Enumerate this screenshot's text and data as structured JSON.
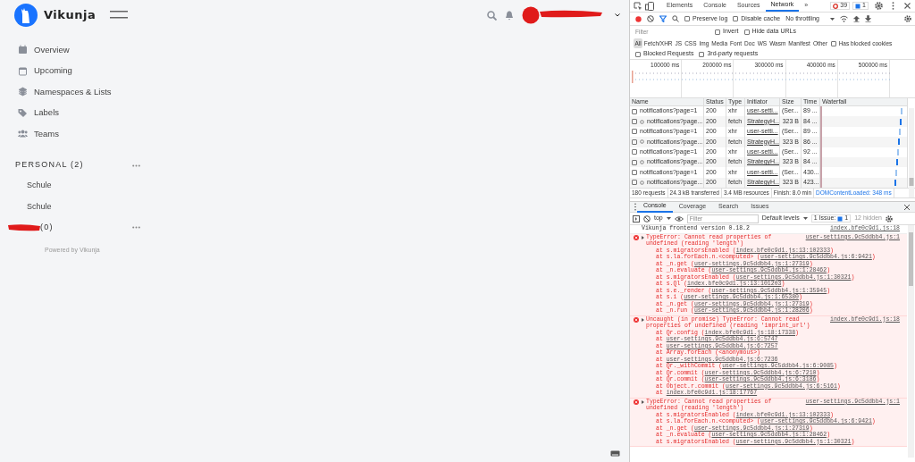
{
  "app": {
    "brand": "Vikunja",
    "header": {
      "user": {
        "redacted": true
      }
    },
    "nav": [
      {
        "label": "Overview"
      },
      {
        "label": "Upcoming"
      },
      {
        "label": "Namespaces & Lists"
      },
      {
        "label": "Labels"
      },
      {
        "label": "Teams"
      }
    ],
    "namespaces": [
      {
        "title": "PERSONAL (2)",
        "redacted": false,
        "lists": [
          "Schule",
          "Schule"
        ]
      },
      {
        "title": "(0)",
        "redacted": true
      }
    ],
    "footer": "Powered by Vikunja"
  },
  "devtools": {
    "tabs": [
      {
        "label": "Elements",
        "selected": false
      },
      {
        "label": "Console",
        "selected": false
      },
      {
        "label": "Sources",
        "selected": false
      },
      {
        "label": "Network",
        "selected": true
      },
      {
        "label": "»",
        "selected": false
      }
    ],
    "error_count": "39",
    "issue_count": "1",
    "network_toolbar": {
      "preserve_log": {
        "label": "Preserve log",
        "checked": false
      },
      "disable_cache": {
        "label": "Disable cache",
        "checked": false
      },
      "throttling": "No throttling"
    },
    "filter": {
      "placeholder": "Filter",
      "invert": {
        "label": "Invert",
        "checked": false
      },
      "hide_data_urls": {
        "label": "Hide data URLs",
        "checked": false
      }
    },
    "type_filters": [
      {
        "label": "All",
        "selected": true
      },
      {
        "label": "Fetch/XHR",
        "selected": false
      },
      {
        "label": "JS",
        "selected": false
      },
      {
        "label": "CSS",
        "selected": false
      },
      {
        "label": "Img",
        "selected": false
      },
      {
        "label": "Media",
        "selected": false
      },
      {
        "label": "Font",
        "selected": false
      },
      {
        "label": "Doc",
        "selected": false
      },
      {
        "label": "WS",
        "selected": false
      },
      {
        "label": "Wasm",
        "selected": false
      },
      {
        "label": "Manifest",
        "selected": false
      },
      {
        "label": "Other",
        "selected": false
      }
    ],
    "extra_filters": [
      {
        "label": "Has blocked cookies",
        "checked": false
      },
      {
        "label": "Blocked Requests",
        "checked": false
      },
      {
        "label": "3rd-party requests",
        "checked": false
      }
    ],
    "timeline_ticks": [
      "100000 ms",
      "200000 ms",
      "300000 ms",
      "400000 ms",
      "500000 ms"
    ],
    "table": {
      "columns": [
        "Name",
        "Status",
        "Type",
        "Initiator",
        "Size",
        "Time",
        "Waterfall"
      ],
      "rows": [
        {
          "kind": "xhr",
          "name": "notifications?page=1",
          "status": "200",
          "type": "xhr",
          "initiator": "user-setti...",
          "size": "(Ser...",
          "time": "89 ...",
          "checked": false
        },
        {
          "kind": "fetch",
          "name": "notifications?page...",
          "status": "200",
          "type": "fetch",
          "initiator": "StrategyH...",
          "size": "323 B",
          "time": "84 ...",
          "checked": false
        },
        {
          "kind": "xhr",
          "name": "notifications?page=1",
          "status": "200",
          "type": "xhr",
          "initiator": "user-setti...",
          "size": "(Ser...",
          "time": "89 ...",
          "checked": false
        },
        {
          "kind": "fetch",
          "name": "notifications?page...",
          "status": "200",
          "type": "fetch",
          "initiator": "StrategyH...",
          "size": "323 B",
          "time": "86 ...",
          "checked": false
        },
        {
          "kind": "xhr",
          "name": "notifications?page=1",
          "status": "200",
          "type": "xhr",
          "initiator": "user-setti...",
          "size": "(Ser...",
          "time": "92 ...",
          "checked": false
        },
        {
          "kind": "fetch",
          "name": "notifications?page...",
          "status": "200",
          "type": "fetch",
          "initiator": "StrategyH...",
          "size": "323 B",
          "time": "84 ...",
          "checked": false
        },
        {
          "kind": "xhr",
          "name": "notifications?page=1",
          "status": "200",
          "type": "xhr",
          "initiator": "user-setti...",
          "size": "(Ser...",
          "time": "430...",
          "checked": false
        },
        {
          "kind": "fetch",
          "name": "notifications?page...",
          "status": "200",
          "type": "fetch",
          "initiator": "StrategyH...",
          "size": "323 B",
          "time": "423...",
          "checked": false
        }
      ]
    },
    "summary": [
      {
        "text": "180 requests",
        "highlight": false
      },
      {
        "text": "24.3 kB transferred",
        "highlight": false
      },
      {
        "text": "3.4 MB resources",
        "highlight": false
      },
      {
        "text": "Finish: 8.0 min",
        "highlight": false
      },
      {
        "text": "DOMContentLoaded: 348 ms",
        "highlight": true
      }
    ],
    "drawer_tabs": [
      {
        "label": "Console",
        "selected": true
      },
      {
        "label": "Coverage",
        "selected": false
      },
      {
        "label": "Search",
        "selected": false
      },
      {
        "label": "Issues",
        "selected": false
      }
    ],
    "console_toolbar": {
      "context": "top",
      "filter_placeholder": "Filter",
      "levels": "Default levels",
      "issues_label": "1 Issue:",
      "issues_count": "1",
      "hidden": "12 hidden"
    },
    "messages": [
      {
        "kind": "log",
        "text": "Vikunja frontend version 0.18.2",
        "source": "index.bfe0c9d1.js:18"
      },
      {
        "kind": "error",
        "text": "TypeError: Cannot read properties of undefined (reading 'length')",
        "source": "user-settings.9c5ddbb4.js:1",
        "frames": [
          {
            "pre": "at s.migratorsEnabled (",
            "link": "index.bfe0c9d1.js:13:102333",
            "post": ")"
          },
          {
            "pre": "at s.la.forEach.n.<computed> (",
            "link": "user-settings.9c5ddbb4.js:6:9421",
            "post": ")"
          },
          {
            "pre": "at _n.get (",
            "link": "user-settings.9c5ddbb4.js:1:27319",
            "post": ")"
          },
          {
            "pre": "at _n.evaluate (",
            "link": "user-settings.9c5ddbb4.js:1:28462",
            "post": ")"
          },
          {
            "pre": "at s.migratorsEnabled (",
            "link": "user-settings.9c5ddbb4.js:1:30321",
            "post": ")"
          },
          {
            "pre": "at s.Ql (",
            "link": "index.bfe0c9d1.js:13:101203",
            "post": ")"
          },
          {
            "pre": "at s.e._render (",
            "link": "user-settings.9c5ddbb4.js:1:35945",
            "post": ")"
          },
          {
            "pre": "at s.i (",
            "link": "user-settings.9c5ddbb4.js:1:65380",
            "post": ")"
          },
          {
            "pre": "at _n.get (",
            "link": "user-settings.9c5ddbb4.js:1:27319",
            "post": ")"
          },
          {
            "pre": "at _n.run (",
            "link": "user-settings.9c5ddbb4.js:1:28206",
            "post": ")"
          }
        ]
      },
      {
        "kind": "error",
        "text": "Uncaught (in promise) TypeError: Cannot read properties of undefined (reading 'imprint_url')",
        "source": "index.bfe0c9d1.js:18",
        "frames": [
          {
            "pre": "at Qr.config (",
            "link": "index.bfe0c9d1.js:18:17338",
            "post": ")"
          },
          {
            "pre": "at ",
            "link": "user-settings.9c5ddbb4.js:6:5747"
          },
          {
            "pre": "at ",
            "link": "user-settings.9c5ddbb4.js:6:7257"
          },
          {
            "pre": "at Array.forEach (<anonymous>)"
          },
          {
            "pre": "at ",
            "link": "user-settings.9c5ddbb4.js:6:7236"
          },
          {
            "pre": "at Qr._withCommit (",
            "link": "user-settings.9c5ddbb4.js:6:9085",
            "post": ")"
          },
          {
            "pre": "at Qr.commit (",
            "link": "user-settings.9c5ddbb4.js:6:7210",
            "post": ")"
          },
          {
            "pre": "at Qr.commit (",
            "link": "user-settings.9c5ddbb4.js:6:3186",
            "post": ")"
          },
          {
            "pre": "at Object.r.commit (",
            "link": "user-settings.9c5ddbb4.js:6:5161",
            "post": ")"
          },
          {
            "pre": "at ",
            "link": "index.bfe0c9d1.js:18:17767"
          }
        ]
      },
      {
        "kind": "error",
        "text": "TypeError: Cannot read properties of undefined (reading 'length')",
        "source": "user-settings.9c5ddbb4.js:1",
        "frames": [
          {
            "pre": "at s.migratorsEnabled (",
            "link": "index.bfe0c9d1.js:13:102333",
            "post": ")"
          },
          {
            "pre": "at s.la.forEach.n.<computed> (",
            "link": "user-settings.9c5ddbb4.js:6:9421",
            "post": ")"
          },
          {
            "pre": "at _n.get (",
            "link": "user-settings.9c5ddbb4.js:1:27319",
            "post": ")"
          },
          {
            "pre": "at _n.evaluate (",
            "link": "user-settings.9c5ddbb4.js:1:28462",
            "post": ")"
          },
          {
            "pre": "at s.migratorsEnabled (",
            "link": "user-settings.9c5ddbb4.js:1:30321",
            "post": ")"
          }
        ]
      }
    ]
  }
}
